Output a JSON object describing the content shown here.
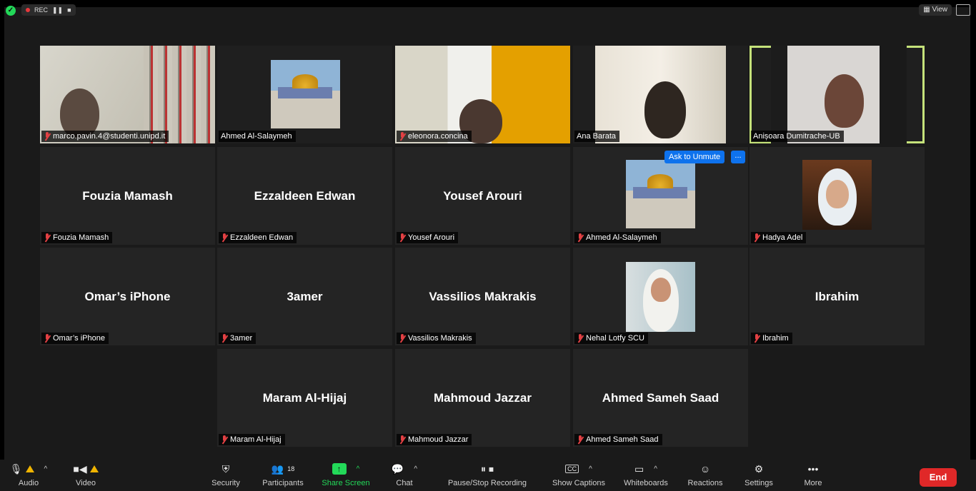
{
  "topbar": {
    "rec_label": "REC",
    "view_label": "View"
  },
  "tiles_video": [
    {
      "name": "marco.pavin.4@studenti.unipd.it"
    },
    {
      "name": "Ahmed Al-Salaymeh"
    },
    {
      "name": "eleonora.concina"
    },
    {
      "name": "Ana Barata"
    },
    {
      "name": "Anișoara Dumitrache-UB"
    }
  ],
  "tiles_row2": [
    {
      "display": "Fouzia Mamash",
      "name": "Fouzia Mamash"
    },
    {
      "display": "Ezzaldeen Edwan",
      "name": "Ezzaldeen Edwan"
    },
    {
      "display": "Yousef Arouri",
      "name": "Yousef Arouri"
    },
    {
      "display": "",
      "name": "Ahmed Al-Salaymeh"
    },
    {
      "display": "",
      "name": "Hadya Adel"
    }
  ],
  "tiles_row3": [
    {
      "display": "Omar’s iPhone",
      "name": "Omar’s iPhone"
    },
    {
      "display": "3amer",
      "name": "3amer"
    },
    {
      "display": "Vassilios Makrakis",
      "name": "Vassilios Makrakis"
    },
    {
      "display": "",
      "name": "Nehal Lotfy SCU"
    },
    {
      "display": "Ibrahim",
      "name": "Ibrahim"
    }
  ],
  "tiles_row4": [
    {
      "display": "Maram Al-Hijaj",
      "name": "Maram Al-Hijaj"
    },
    {
      "display": "Mahmoud Jazzar",
      "name": "Mahmoud Jazzar"
    },
    {
      "display": "Ahmed Sameh Saad",
      "name": "Ahmed Sameh Saad"
    }
  ],
  "ask_unmute": "Ask to Unmute",
  "more_dots": "...",
  "toolbar": {
    "audio": "Audio",
    "video": "Video",
    "security": "Security",
    "participants": "Participants",
    "participants_count": "18",
    "share_screen": "Share Screen",
    "chat": "Chat",
    "recording": "Pause/Stop Recording",
    "captions": "Show Captions",
    "captions_icon": "CC",
    "whiteboards": "Whiteboards",
    "reactions": "Reactions",
    "settings": "Settings",
    "more": "More",
    "end": "End"
  },
  "colors": {
    "accent_green": "#23d959",
    "end_red": "#e02828",
    "unmute_blue": "#0e72ed",
    "active_border": "#c5e27a"
  }
}
